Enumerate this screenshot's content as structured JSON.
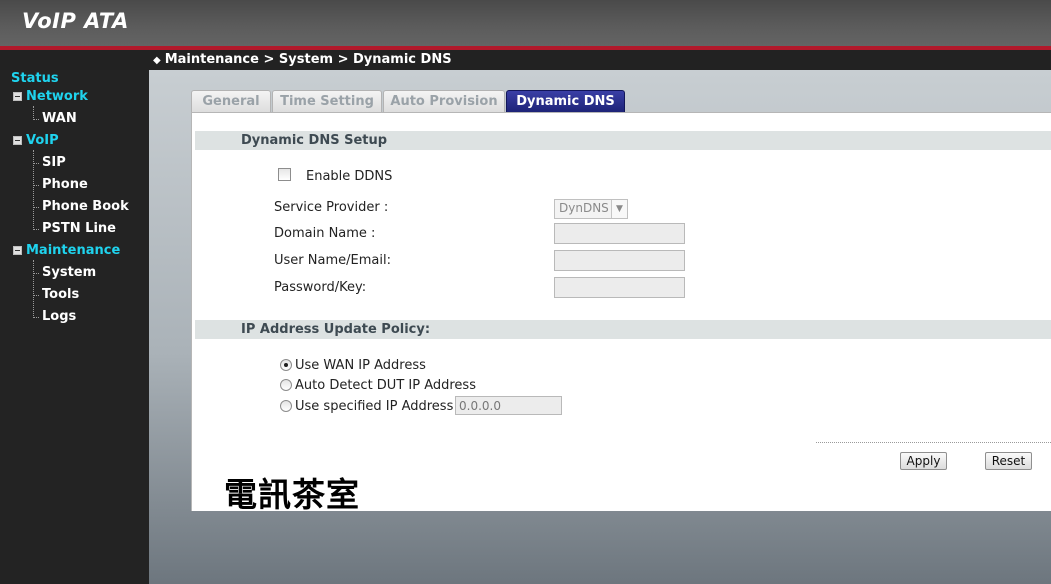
{
  "header": {
    "title": "VoIP ATA"
  },
  "breadcrumb": {
    "text": "Maintenance > System > Dynamic DNS"
  },
  "sidebar": {
    "status": "Status",
    "network": "Network",
    "wan": "WAN",
    "voip": "VoIP",
    "sip": "SIP",
    "phone": "Phone",
    "phone_book": "Phone Book",
    "pstn_line": "PSTN Line",
    "maintenance": "Maintenance",
    "system": "System",
    "tools": "Tools",
    "logs": "Logs"
  },
  "tabs": {
    "general": "General",
    "time_setting": "Time Setting",
    "auto_provision": "Auto Provision",
    "dynamic_dns": "Dynamic DNS"
  },
  "ddns": {
    "section_title": "Dynamic DNS Setup",
    "enable_label": "Enable DDNS",
    "enable_checked": false,
    "service_provider_label": "Service Provider :",
    "service_provider_value": "DynDNS",
    "domain_name_label": "Domain Name :",
    "domain_name_value": "",
    "username_label": "User Name/Email:",
    "username_value": "",
    "password_label": "Password/Key:",
    "password_value": ""
  },
  "policy": {
    "section_title": "IP Address Update Policy:",
    "option_wan": "Use WAN IP Address",
    "option_auto": "Auto Detect DUT IP Address",
    "option_specified": "Use specified IP Address",
    "specified_ip": "0.0.0.0",
    "selected": "wan"
  },
  "buttons": {
    "apply": "Apply",
    "reset": "Reset"
  },
  "watermark": "電訊茶室"
}
